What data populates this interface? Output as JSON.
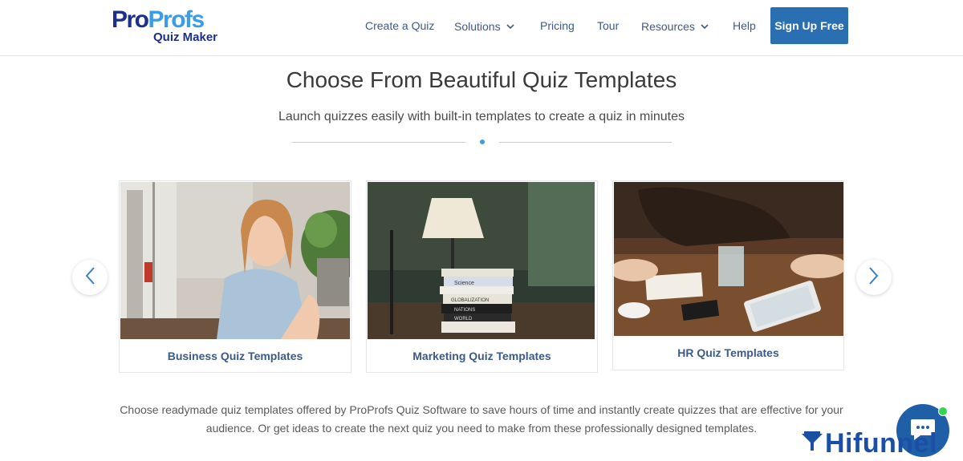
{
  "header": {
    "logo": {
      "brand_pro": "Pro",
      "brand_profs": "Profs",
      "product": "Quiz Maker"
    },
    "nav": [
      {
        "label": "Create a Quiz",
        "has_dropdown": false
      },
      {
        "label": "Solutions",
        "has_dropdown": true
      },
      {
        "label": "Pricing",
        "has_dropdown": false
      },
      {
        "label": "Tour",
        "has_dropdown": false
      },
      {
        "label": "Resources",
        "has_dropdown": true
      },
      {
        "label": "Help",
        "has_dropdown": false
      }
    ],
    "cta_label": "Sign Up Free"
  },
  "hero": {
    "title": "Choose From Beautiful Quiz Templates",
    "subtitle": "Launch quizzes easily with built-in templates to create a quiz in minutes"
  },
  "carousel": {
    "prev_icon": "chevron-left-icon",
    "next_icon": "chevron-right-icon",
    "cards": [
      {
        "label": "Business Quiz Templates",
        "image": "woman-smiling-photo"
      },
      {
        "label": "Marketing Quiz Templates",
        "image": "books-and-lamp-photo"
      },
      {
        "label": "HR Quiz Templates",
        "image": "desk-meeting-photo"
      }
    ],
    "book_spines": [
      "Science",
      "GLOBALIZATION",
      "NATIONS",
      "WORLD"
    ]
  },
  "description": {
    "line1": "Choose readymade quiz templates offered by ProProfs Quiz Software to save hours of time and instantly create quizzes that are effective for your",
    "line2": "audience. Or get ideas to create the next quiz you need to make from these professionally designed templates."
  },
  "widgets": {
    "chat_icon": "chat-bubble-icon",
    "badge_text": "Hifunnel"
  },
  "colors": {
    "brand_dark": "#1c2f8f",
    "brand_light": "#3a9be8",
    "cta": "#2a6fb2",
    "nav_text": "#3d5a87"
  }
}
